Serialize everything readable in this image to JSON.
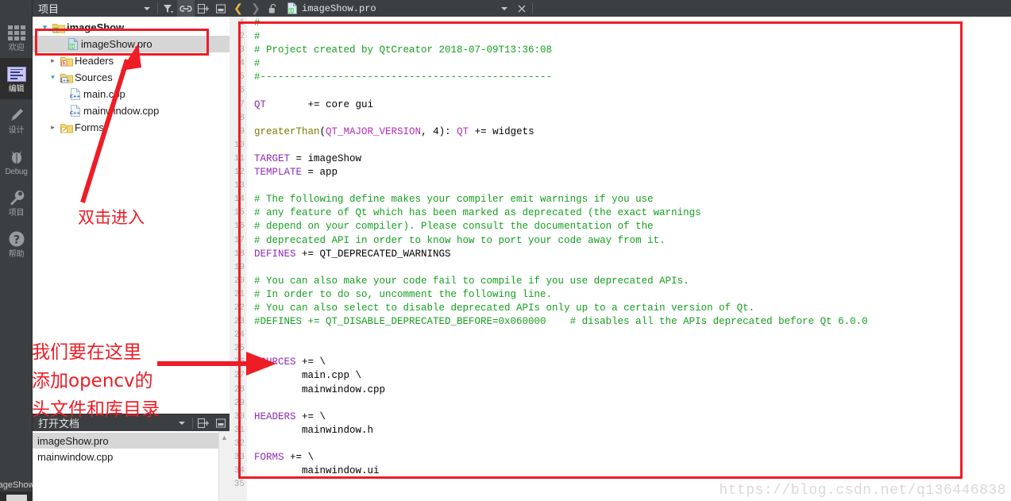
{
  "modebar": {
    "items": [
      {
        "label": "欢迎",
        "icon": "grid-icon",
        "active": false
      },
      {
        "label": "编辑",
        "icon": "edit-lines-icon",
        "active": true
      },
      {
        "label": "设计",
        "icon": "pencil-icon",
        "active": false
      },
      {
        "label": "Debug",
        "icon": "bug-icon",
        "active": false
      },
      {
        "label": "项目",
        "icon": "wrench-icon",
        "active": false
      },
      {
        "label": "帮助",
        "icon": "question-mark-icon",
        "active": false
      }
    ],
    "bottom_tag": "imageShow"
  },
  "project_panel": {
    "title": "项目",
    "toolbar_icons": [
      "chevron-down-icon",
      "filter-icon",
      "link-icon",
      "split-add-icon",
      "close-split-icon"
    ],
    "tree": [
      {
        "label": "imageShow",
        "indent": 0,
        "twisty": "open",
        "icon": "qt-folder-icon",
        "bold": true,
        "selected": false
      },
      {
        "label": "imageShow.pro",
        "indent": 1,
        "twisty": "none",
        "icon": "qt-pro-file-icon",
        "bold": false,
        "selected": true
      },
      {
        "label": "Headers",
        "indent": 1,
        "twisty": "closed",
        "icon": "h-folder-icon",
        "bold": false,
        "selected": false
      },
      {
        "label": "Sources",
        "indent": 1,
        "twisty": "open",
        "icon": "cpp-folder-icon",
        "bold": false,
        "selected": false
      },
      {
        "label": "main.cpp",
        "indent": 2,
        "twisty": "none",
        "icon": "cpp-file-icon",
        "bold": false,
        "selected": false
      },
      {
        "label": "mainwindow.cpp",
        "indent": 2,
        "twisty": "none",
        "icon": "cpp-file-icon",
        "bold": false,
        "selected": false
      },
      {
        "label": "Forms",
        "indent": 1,
        "twisty": "closed",
        "icon": "ui-folder-icon",
        "bold": false,
        "selected": false
      }
    ]
  },
  "open_documents": {
    "title": "打开文档",
    "toolbar_icons": [
      "chevron-down-icon",
      "split-add-icon",
      "close-split-icon"
    ],
    "items": [
      {
        "label": "imageShow.pro",
        "selected": true
      },
      {
        "label": "mainwindow.cpp",
        "selected": false
      }
    ]
  },
  "editor_toolbar": {
    "back_icon": "back-arrow-icon",
    "forward_icon": "forward-arrow-icon",
    "lock_icon": "unlocked-padlock-icon",
    "file_icon": "qt-pro-file-icon",
    "filename": "imageShow.pro",
    "dropdown_icon": "chevron-down-icon",
    "close_icon": "close-icon"
  },
  "code": {
    "first_line": 1,
    "lines": [
      {
        "n": 1,
        "tokens": [
          {
            "t": "#-------------------------------------------------",
            "c": "tok-c"
          }
        ]
      },
      {
        "n": 2,
        "tokens": [
          {
            "t": "#",
            "c": "tok-c"
          }
        ]
      },
      {
        "n": 3,
        "tokens": [
          {
            "t": "# Project created by QtCreator 2018-07-09T13:36:08",
            "c": "tok-c"
          }
        ]
      },
      {
        "n": 4,
        "tokens": [
          {
            "t": "#",
            "c": "tok-c"
          }
        ]
      },
      {
        "n": 5,
        "tokens": [
          {
            "t": "#-------------------------------------------------",
            "c": "tok-c"
          }
        ]
      },
      {
        "n": 6,
        "tokens": []
      },
      {
        "n": 7,
        "tokens": [
          {
            "t": "QT",
            "c": "tok-k"
          },
          {
            "t": "       += core gui",
            "c": "tok-p"
          }
        ]
      },
      {
        "n": 8,
        "tokens": []
      },
      {
        "n": 9,
        "tokens": [
          {
            "t": "greaterThan",
            "c": "tok-f"
          },
          {
            "t": "(",
            "c": "tok-p"
          },
          {
            "t": "QT_MAJOR_VERSION",
            "c": "tok-m"
          },
          {
            "t": ", 4): ",
            "c": "tok-p"
          },
          {
            "t": "QT",
            "c": "tok-m"
          },
          {
            "t": " += widgets",
            "c": "tok-p"
          }
        ]
      },
      {
        "n": 10,
        "tokens": []
      },
      {
        "n": 11,
        "tokens": [
          {
            "t": "TARGET",
            "c": "tok-k"
          },
          {
            "t": " = imageShow",
            "c": "tok-p"
          }
        ]
      },
      {
        "n": 12,
        "tokens": [
          {
            "t": "TEMPLATE",
            "c": "tok-k"
          },
          {
            "t": " = app",
            "c": "tok-p"
          }
        ]
      },
      {
        "n": 13,
        "tokens": []
      },
      {
        "n": 14,
        "tokens": [
          {
            "t": "# The following define makes your compiler emit warnings if you use",
            "c": "tok-c"
          }
        ]
      },
      {
        "n": 15,
        "tokens": [
          {
            "t": "# any feature of Qt which has been marked as deprecated (the exact warnings",
            "c": "tok-c"
          }
        ]
      },
      {
        "n": 16,
        "tokens": [
          {
            "t": "# depend on your compiler). Please consult the documentation of the",
            "c": "tok-c"
          }
        ]
      },
      {
        "n": 17,
        "tokens": [
          {
            "t": "# deprecated API in order to know how to port your code away from it.",
            "c": "tok-c"
          }
        ]
      },
      {
        "n": 18,
        "tokens": [
          {
            "t": "DEFINES",
            "c": "tok-k"
          },
          {
            "t": " += QT_DEPRECATED_WARNINGS",
            "c": "tok-p"
          }
        ]
      },
      {
        "n": 19,
        "tokens": []
      },
      {
        "n": 20,
        "tokens": [
          {
            "t": "# You can also make your code fail to compile if you use deprecated APIs.",
            "c": "tok-c"
          }
        ]
      },
      {
        "n": 21,
        "tokens": [
          {
            "t": "# In order to do so, uncomment the following line.",
            "c": "tok-c"
          }
        ]
      },
      {
        "n": 22,
        "tokens": [
          {
            "t": "# You can also select to disable deprecated APIs only up to a certain version of Qt.",
            "c": "tok-c"
          }
        ]
      },
      {
        "n": 23,
        "tokens": [
          {
            "t": "#DEFINES += QT_DISABLE_DEPRECATED_BEFORE=0x060000    # disables all the APIs deprecated before Qt 6.0.0",
            "c": "tok-c"
          }
        ]
      },
      {
        "n": 24,
        "tokens": []
      },
      {
        "n": 25,
        "tokens": []
      },
      {
        "n": 26,
        "tokens": [
          {
            "t": "SOURCES",
            "c": "tok-k"
          },
          {
            "t": " += \\",
            "c": "tok-p"
          }
        ]
      },
      {
        "n": 27,
        "tokens": [
          {
            "t": "        main.cpp \\",
            "c": "tok-p"
          }
        ]
      },
      {
        "n": 28,
        "tokens": [
          {
            "t": "        mainwindow.cpp",
            "c": "tok-p"
          }
        ]
      },
      {
        "n": 29,
        "tokens": []
      },
      {
        "n": 30,
        "tokens": [
          {
            "t": "HEADERS",
            "c": "tok-k"
          },
          {
            "t": " += \\",
            "c": "tok-p"
          }
        ]
      },
      {
        "n": 31,
        "tokens": [
          {
            "t": "        mainwindow.h",
            "c": "tok-p"
          }
        ]
      },
      {
        "n": 32,
        "tokens": []
      },
      {
        "n": 33,
        "tokens": [
          {
            "t": "FORMS",
            "c": "tok-k"
          },
          {
            "t": " += \\",
            "c": "tok-p"
          }
        ]
      },
      {
        "n": 34,
        "tokens": [
          {
            "t": "        mainwindow.ui",
            "c": "tok-p"
          }
        ]
      },
      {
        "n": 35,
        "tokens": []
      }
    ]
  },
  "annotations": {
    "color": "#ee1c25",
    "note_double_click": "双击进入",
    "note_add_opencv": "我们要在这里\n添加opencv的\n头文件和库目录"
  },
  "watermark": "https://blog.csdn.net/q136446838"
}
